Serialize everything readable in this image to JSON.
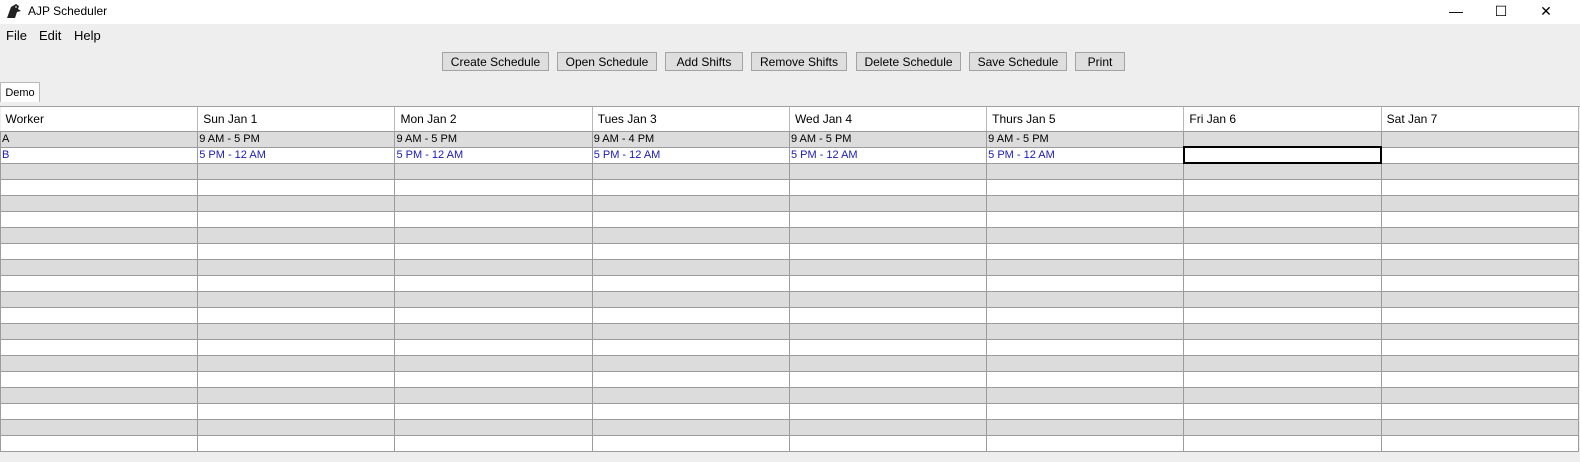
{
  "window": {
    "title": "AJP Scheduler",
    "minimize_glyph": "—",
    "maximize_glyph": "☐",
    "close_glyph": "✕"
  },
  "menu": [
    "File",
    "Edit",
    "Help"
  ],
  "toolbar": [
    "Create Schedule",
    "Open Schedule",
    "Add Shifts",
    "Remove Shifts",
    "Delete Schedule",
    "Save Schedule",
    "Print"
  ],
  "tabs": [
    "Demo"
  ],
  "table": {
    "headers": [
      "Worker",
      "Sun Jan 1",
      "Mon Jan 2",
      "Tues Jan 3",
      "Wed Jan 4",
      "Thurs Jan 5",
      "Fri Jan 6",
      "Sat Jan 7"
    ],
    "rows": [
      [
        "A",
        "9 AM - 5 PM",
        "9 AM - 5 PM",
        "9 AM - 4 PM",
        "9 AM - 5 PM",
        "9 AM - 5 PM",
        "",
        ""
      ],
      [
        "B",
        "5 PM - 12 AM",
        "5 PM - 12 AM",
        "5 PM - 12 AM",
        "5 PM - 12 AM",
        "5 PM - 12 AM",
        "",
        ""
      ]
    ],
    "empty_row_count": 18,
    "selected_cell": {
      "row": 1,
      "col": 6
    }
  }
}
